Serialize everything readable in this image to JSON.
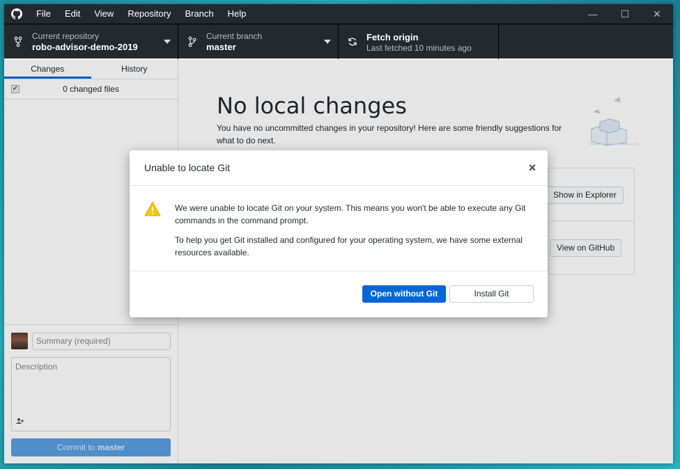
{
  "menu": [
    "File",
    "Edit",
    "View",
    "Repository",
    "Branch",
    "Help"
  ],
  "window_controls": {
    "minimize": "—",
    "maximize": "☐",
    "close": "✕"
  },
  "toolbar": {
    "repo_label": "Current repository",
    "repo_value": "robo-advisor-demo-2019",
    "branch_label": "Current branch",
    "branch_value": "master",
    "fetch_title": "Fetch origin",
    "fetch_sub": "Last fetched 10 minutes ago"
  },
  "sidebar": {
    "tabs": [
      "Changes",
      "History"
    ],
    "changed_files": "0 changed files",
    "summary_placeholder": "Summary (required)",
    "description_placeholder": "Description",
    "commit_prefix": "Commit to",
    "commit_branch": "master"
  },
  "content": {
    "title": "No local changes",
    "subtitle": "You have no uncommitted changes in your repository! Here are some friendly suggestions for what to do next.",
    "show_in_explorer": "Show in Explorer",
    "view_on_github": "View on GitHub"
  },
  "dialog": {
    "title": "Unable to locate Git",
    "p1": "We were unable to locate Git on your system. This means you won't be able to execute any Git commands in the command prompt.",
    "p2": "To help you get Git installed and configured for your operating system, we have some external resources available.",
    "primary": "Open without Git",
    "secondary": "Install Git"
  },
  "colors": {
    "accent": "#0366d6",
    "titlebar": "#24292e",
    "warning": "#f9c513"
  }
}
